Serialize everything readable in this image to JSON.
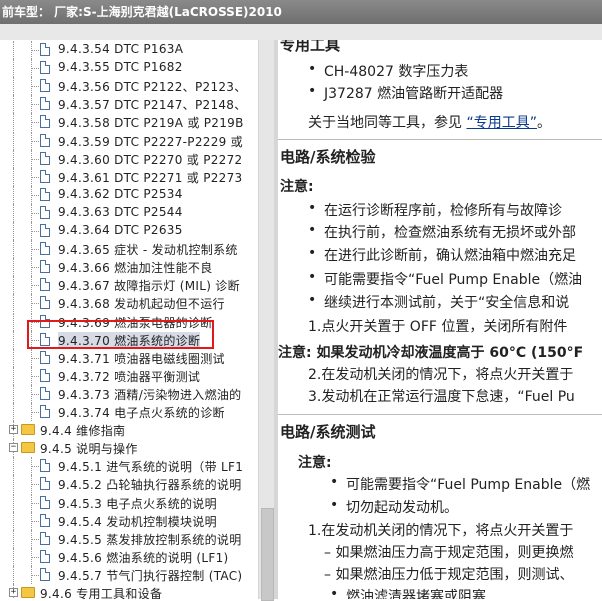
{
  "window": {
    "title": "前车型：  厂家:S-上海别克君越(LaCROSSE)2010"
  },
  "tree": {
    "items": [
      {
        "label": "9.4.3.54 DTC P163A",
        "type": "doc"
      },
      {
        "label": "9.4.3.55 DTC P1682",
        "type": "doc"
      },
      {
        "label": "9.4.3.56 DTC P2122、P2123、",
        "type": "doc"
      },
      {
        "label": "9.4.3.57 DTC P2147、P2148、",
        "type": "doc"
      },
      {
        "label": "9.4.3.58 DTC P219A 或 P219B",
        "type": "doc"
      },
      {
        "label": "9.4.3.59 DTC P2227-P2229 或",
        "type": "doc"
      },
      {
        "label": "9.4.3.60 DTC P2270 或 P2272",
        "type": "doc"
      },
      {
        "label": "9.4.3.61 DTC P2271 或 P2273",
        "type": "doc"
      },
      {
        "label": "9.4.3.62 DTC P2534",
        "type": "doc"
      },
      {
        "label": "9.4.3.63 DTC P2544",
        "type": "doc"
      },
      {
        "label": "9.4.3.64 DTC P2635",
        "type": "doc"
      },
      {
        "label": "9.4.3.65 症状 - 发动机控制系统",
        "type": "doc"
      },
      {
        "label": "9.4.3.66 燃油加注性能不良",
        "type": "doc"
      },
      {
        "label": "9.4.3.67 故障指示灯 (MIL) 诊断",
        "type": "doc"
      },
      {
        "label": "9.4.3.68 发动机起动但不运行",
        "type": "doc"
      },
      {
        "label": "9.4.3.69 燃油泵电器的诊断",
        "type": "doc"
      },
      {
        "label": "9.4.3.70 燃油系统的诊断",
        "type": "doc",
        "selected": true
      },
      {
        "label": "9.4.3.71 喷油器电磁线圈测试",
        "type": "doc"
      },
      {
        "label": "9.4.3.72 喷油器平衡测试",
        "type": "doc"
      },
      {
        "label": "9.4.3.73 酒精/污染物进入燃油的",
        "type": "doc"
      },
      {
        "label": "9.4.3.74 电子点火系统的诊断",
        "type": "doc"
      },
      {
        "label": "9.4.4 维修指南",
        "type": "folder",
        "expander": "+"
      },
      {
        "label": "9.4.5 说明与操作",
        "type": "folder",
        "expander": "−"
      },
      {
        "label": "9.4.5.1 进气系统的说明（带 LF1",
        "type": "doc"
      },
      {
        "label": "9.4.5.2 凸轮轴执行器系统的说明",
        "type": "doc"
      },
      {
        "label": "9.4.5.3 电子点火系统的说明",
        "type": "doc"
      },
      {
        "label": "9.4.5.4 发动机控制模块说明",
        "type": "doc"
      },
      {
        "label": "9.4.5.5 蒸发排放控制系统的说明",
        "type": "doc"
      },
      {
        "label": "9.4.5.6 燃油系统的说明 (LF1)",
        "type": "doc"
      },
      {
        "label": "9.4.5.7 节气门执行器控制 (TAC)",
        "type": "doc"
      },
      {
        "label": "9.4.6 专用工具和设备",
        "type": "folder",
        "expander": "+"
      }
    ]
  },
  "content": {
    "tools_heading": "专用工具",
    "tool_1": "CH-48027 数字压力表",
    "tool_2": "J37287 燃油管路断开适配器",
    "equiv_prefix": "关于当地同等工具，参见",
    "equiv_link": "“专用工具”",
    "equiv_suffix": "。",
    "verify_heading": "电路/系统检验",
    "note_label": "注意:",
    "notes": [
      "在运行诊断程序前，检修所有与故障诊",
      "在执行前，检查燃油系统有无损坏或外部",
      "在进行此诊断前，确认燃油箱中燃油充足",
      "可能需要指令“Fuel Pump Enable（燃油",
      "继续进行本测试前，关于“安全信息和说"
    ],
    "step_1": "1.点火开关置于 OFF 位置，关闭所有附件",
    "note_2": "注意: 如果发动机冷却液温度高于 60°C (150°F",
    "step_2": "2.在发动机关闭的情况下，将点火开关置于",
    "step_3": "3.发动机在正常运行温度下怠速，“Fuel Pu",
    "test_heading": "电路/系统测试",
    "test_note_label": "注意:",
    "test_notes": [
      "可能需要指令“Fuel Pump Enable（燃",
      "切勿起动发动机。"
    ],
    "test_step_1": "1.在发动机关闭的情况下，将点火开关置于",
    "test_sub_1": "– 如果燃油压力高于规定范围，则更换燃",
    "test_sub_2": "– 如果燃油压力低于规定范围，则测试、",
    "test_sub_3": "燃油滤清器堵塞或阻塞"
  }
}
